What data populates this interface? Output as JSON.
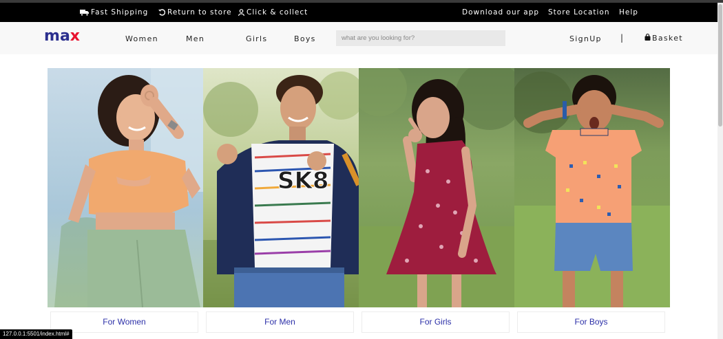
{
  "topbar": {
    "left": [
      {
        "label": "Fast Shipping",
        "icon": "truck-icon"
      },
      {
        "label": "Return to store",
        "icon": "return-icon"
      },
      {
        "label": "Click & collect",
        "icon": "user-icon"
      }
    ],
    "right": [
      "Download our app",
      "Store Location",
      "Help"
    ]
  },
  "brand": {
    "m": "m",
    "a": "a",
    "x": "x",
    "primary": "#2b2f8e",
    "accent": "#e8132f"
  },
  "nav": {
    "links": [
      "Women",
      "Men",
      "Girls",
      "Boys"
    ],
    "search_placeholder": "what are you looking for?",
    "signup": "SignUp",
    "separator": "|",
    "basket": "Basket"
  },
  "categories": [
    {
      "label": "For Women",
      "image": "woman-photo"
    },
    {
      "label": "For Men",
      "image": "man-photo"
    },
    {
      "label": "For Girls",
      "image": "girl-photo"
    },
    {
      "label": "For Boys",
      "image": "boy-photo"
    }
  ],
  "status_url": "127.0.0.1:5501/index.html#"
}
